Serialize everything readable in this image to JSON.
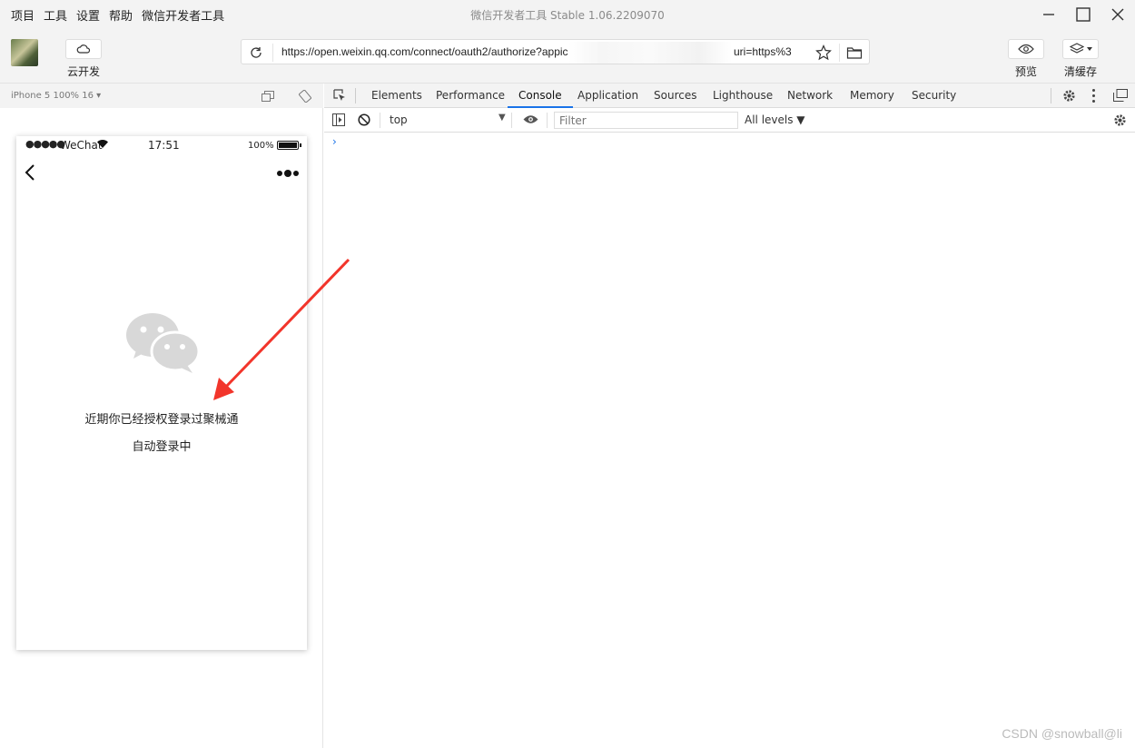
{
  "menu": [
    "项目",
    "工具",
    "设置",
    "帮助",
    "微信开发者工具"
  ],
  "window_title": "微信开发者工具 Stable 1.06.2209070",
  "toolbar": {
    "cloud_label": "云开发",
    "url_start": "https://open.weixin.qq.com/connect/oauth2/authorize?appic",
    "url_end": "uri=https%3",
    "preview_label": "预览",
    "cache_label": "清缓存"
  },
  "simulator": {
    "device": "iPhone 5 100% 16 ▾",
    "status": {
      "signal": "●●●●●",
      "carrier": "WeChat",
      "time": "17:51",
      "battery_pct": "100%"
    },
    "message_line1": "近期你已经授权登录过聚械通",
    "message_line2": "自动登录中"
  },
  "devtools": {
    "tabs": [
      "Elements",
      "Performance",
      "Console",
      "Application",
      "Sources",
      "Lighthouse",
      "Network",
      "Memory",
      "Security"
    ],
    "active_tab": "Console",
    "context": "top",
    "filter_placeholder": "Filter",
    "levels": "All levels ▼",
    "prompt": "›"
  },
  "watermark": "CSDN @snowball@li",
  "colors": {
    "accent": "#1a73e8",
    "arrow": "#f2352b",
    "panel_bg": "#f3f3f3"
  }
}
